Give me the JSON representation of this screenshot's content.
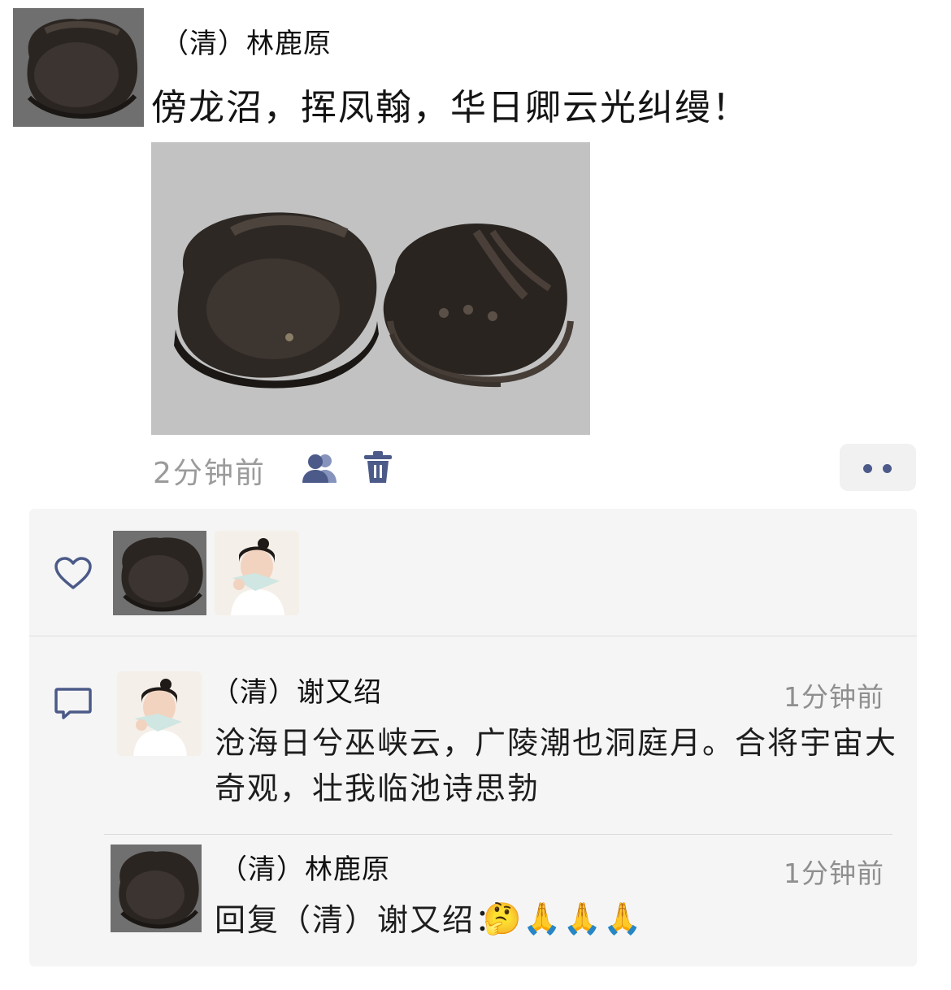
{
  "post": {
    "author": "（清）林鹿原",
    "text": "傍龙沼，挥凤翰，华日卿云光纠缦！",
    "time": "2分钟前"
  },
  "likes": {
    "users": [
      "（清）林鹿原",
      "（清）谢又绍"
    ]
  },
  "comments": [
    {
      "author": "（清）谢又绍",
      "time": "1分钟前",
      "text": "沧海日兮巫峡云，广陵潮也洞庭月。合将宇宙大奇观，壮我临池诗思勃"
    },
    {
      "author": "（清）林鹿原",
      "time": "1分钟前",
      "reply_prefix": "回复（清）谢又绍：",
      "emojis": [
        "🤔",
        "🙏",
        "🙏",
        "🙏"
      ]
    }
  ],
  "icons": {
    "privacy": "two-people-icon",
    "delete": "trash-icon",
    "like": "heart-icon",
    "comment": "comment-bubble-icon",
    "more": "more-dots-icon"
  },
  "colors": {
    "accent": "#4b5a88",
    "time_gray": "#9b9b9b",
    "panel_bg": "#f5f5f5"
  }
}
